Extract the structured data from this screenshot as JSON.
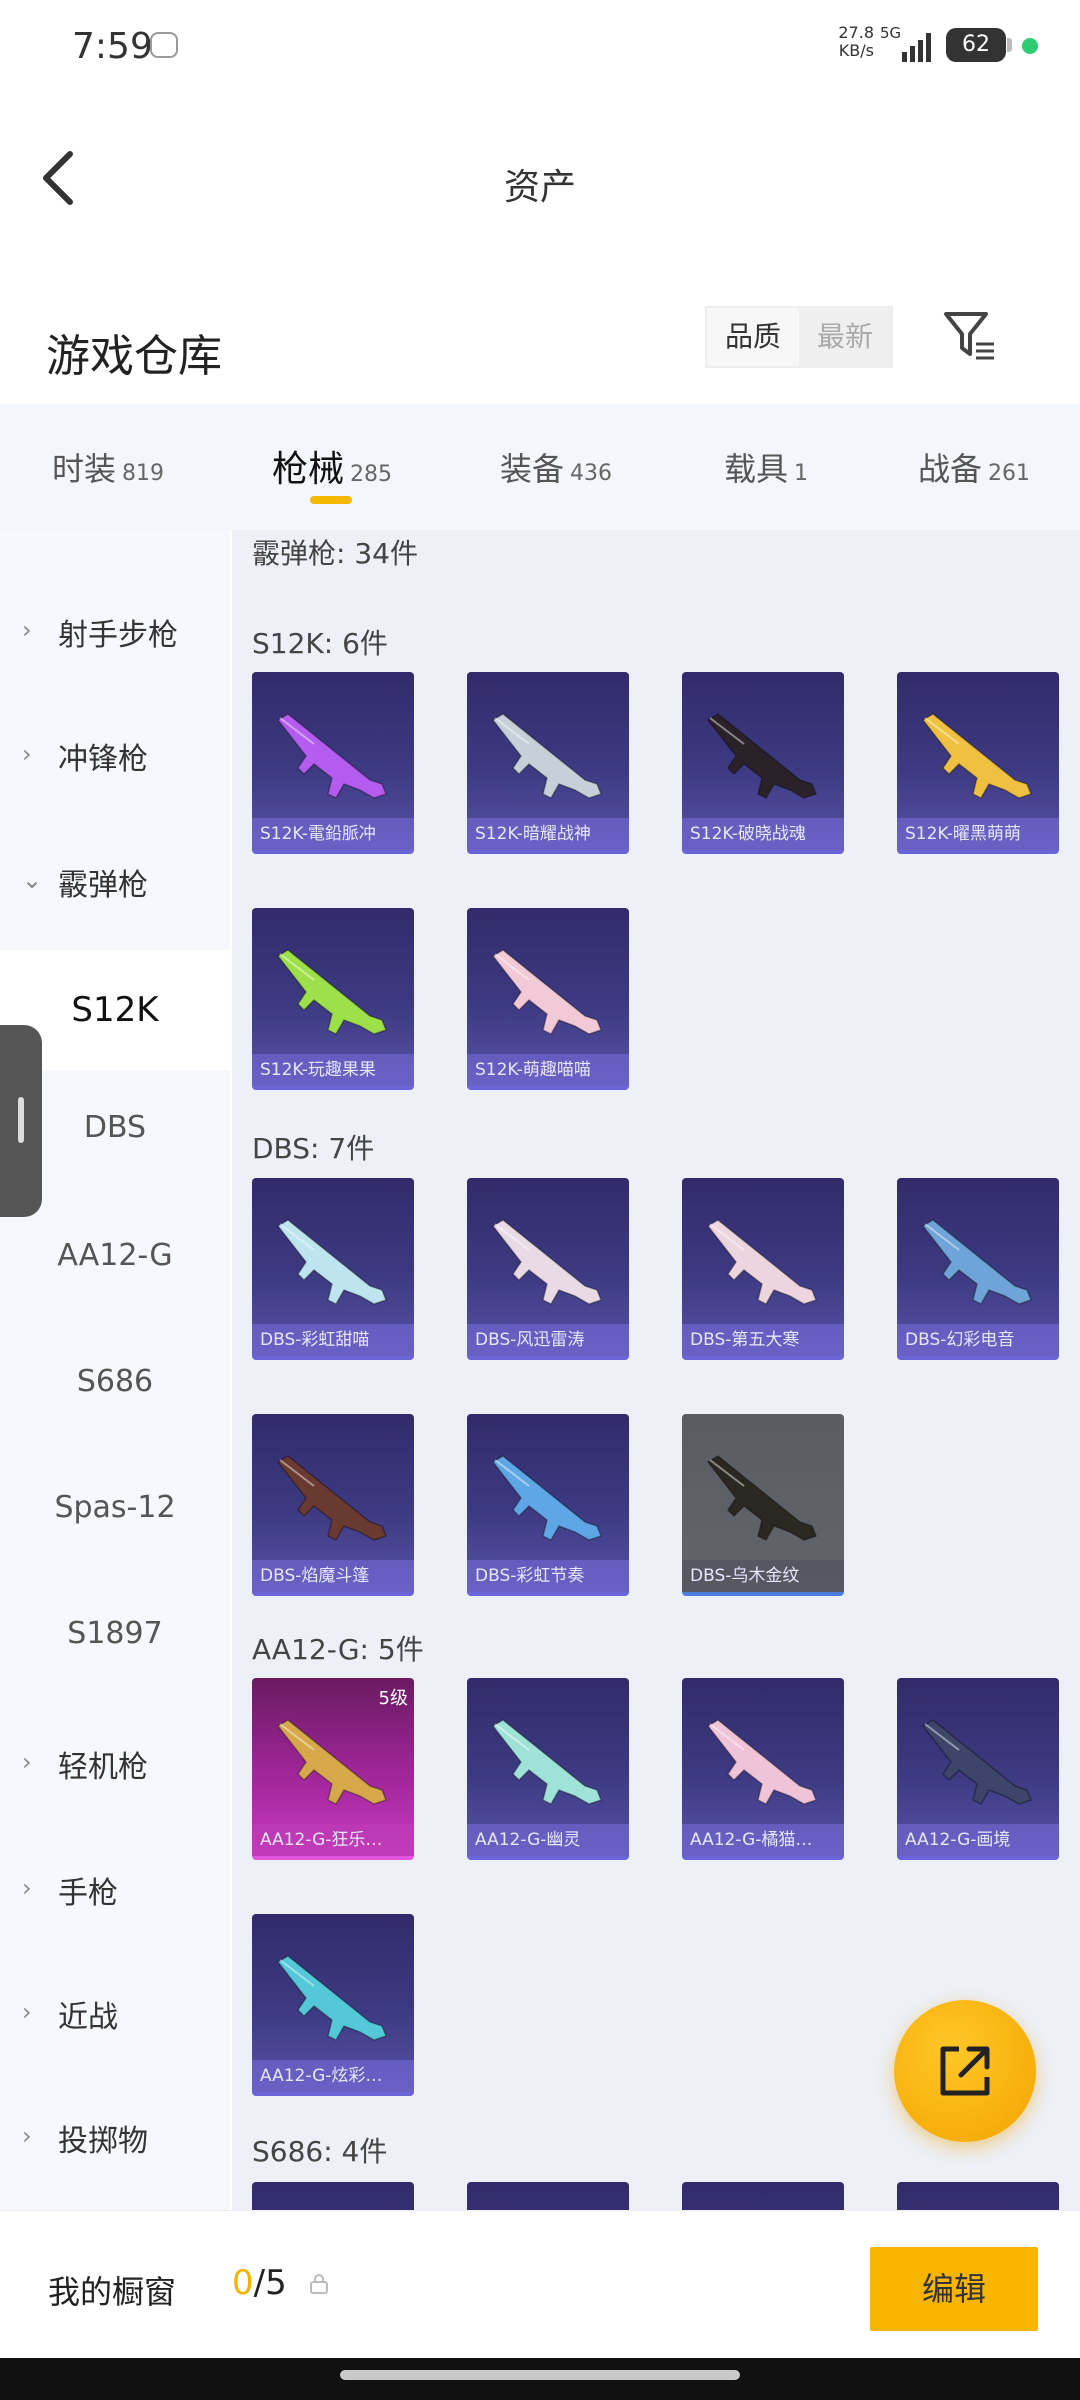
{
  "status_bar": {
    "time": "7:59",
    "net_speed": "27.8 KB/s",
    "network": "5G",
    "battery": "62"
  },
  "header": {
    "title": "资产"
  },
  "warehouse": {
    "title": "游戏仓库",
    "sort": [
      "品质",
      "最新"
    ]
  },
  "tabs": [
    {
      "label": "时装",
      "count": "819"
    },
    {
      "label": "枪械",
      "count": "285"
    },
    {
      "label": "装备",
      "count": "436"
    },
    {
      "label": "载具",
      "count": "1"
    },
    {
      "label": "战备",
      "count": "261"
    }
  ],
  "side_nav": [
    {
      "label": "射手步枪",
      "type": "category"
    },
    {
      "label": "冲锋枪",
      "type": "category"
    },
    {
      "label": "霰弹枪",
      "type": "category-open"
    },
    {
      "label": "S12K",
      "type": "sub-selected"
    },
    {
      "label": "DBS",
      "type": "sub"
    },
    {
      "label": "AA12-G",
      "type": "sub"
    },
    {
      "label": "S686",
      "type": "sub"
    },
    {
      "label": "Spas-12",
      "type": "sub"
    },
    {
      "label": "S1897",
      "type": "sub"
    },
    {
      "label": "轻机枪",
      "type": "category"
    },
    {
      "label": "手枪",
      "type": "category"
    },
    {
      "label": "近战",
      "type": "category"
    },
    {
      "label": "投掷物",
      "type": "category"
    }
  ],
  "content": {
    "top_label": "霰弹枪: 34件",
    "sections": [
      {
        "label": "S12K: 6件",
        "items": [
          {
            "name": "S12K-電鉛脈冲",
            "style": "blue",
            "gun": "#b45cf0"
          },
          {
            "name": "S12K-暗耀战神",
            "style": "blue",
            "gun": "#c7d0d8"
          },
          {
            "name": "S12K-破晓战魂",
            "style": "blue",
            "gun": "#2a2228"
          },
          {
            "name": "S12K-曜黑萌萌",
            "style": "blue",
            "gun": "#f0c040"
          },
          {
            "name": "S12K-玩趣果果",
            "style": "blue",
            "gun": "#9ee04a"
          },
          {
            "name": "S12K-萌趣喵喵",
            "style": "blue",
            "gun": "#f2c9d6"
          }
        ]
      },
      {
        "label": "DBS: 7件",
        "items": [
          {
            "name": "DBS-彩虹甜喵",
            "style": "blue",
            "gun": "#bde4ef"
          },
          {
            "name": "DBS-风迅雷涛",
            "style": "blue",
            "gun": "#e9dbe6"
          },
          {
            "name": "DBS-第五大寒",
            "style": "blue",
            "gun": "#ecd5de"
          },
          {
            "name": "DBS-幻彩电音",
            "style": "blue",
            "gun": "#6ea4d8"
          },
          {
            "name": "DBS-焰魔斗篷",
            "style": "blue",
            "gun": "#6a3a30"
          },
          {
            "name": "DBS-彩虹节奏",
            "style": "blue",
            "gun": "#5fa6e6"
          },
          {
            "name": "DBS-乌木金纹",
            "style": "gray",
            "gun": "#2a2820"
          }
        ]
      },
      {
        "label": "AA12-G: 5件",
        "items": [
          {
            "name": "AA12-G-狂乐…",
            "style": "pink",
            "gun": "#d6a84a",
            "level": "5级"
          },
          {
            "name": "AA12-G-幽灵",
            "style": "blue",
            "gun": "#9fe3d8"
          },
          {
            "name": "AA12-G-橘猫…",
            "style": "blue",
            "gun": "#efc4d8"
          },
          {
            "name": "AA12-G-画境",
            "style": "blue",
            "gun": "#3d4668"
          },
          {
            "name": "AA12-G-炫彩…",
            "style": "blue",
            "gun": "#54c8d8"
          }
        ]
      },
      {
        "label": "S686: 4件",
        "items": [
          {
            "name": "",
            "style": "blue",
            "gun": "#888"
          },
          {
            "name": "",
            "style": "blue",
            "gun": "#888"
          },
          {
            "name": "",
            "style": "blue",
            "gun": "#888"
          },
          {
            "name": "",
            "style": "blue",
            "gun": "#888"
          }
        ]
      }
    ]
  },
  "bottom_bar": {
    "label": "我的橱窗",
    "count_current": "0",
    "count_total": "/5",
    "edit_label": "编辑"
  }
}
